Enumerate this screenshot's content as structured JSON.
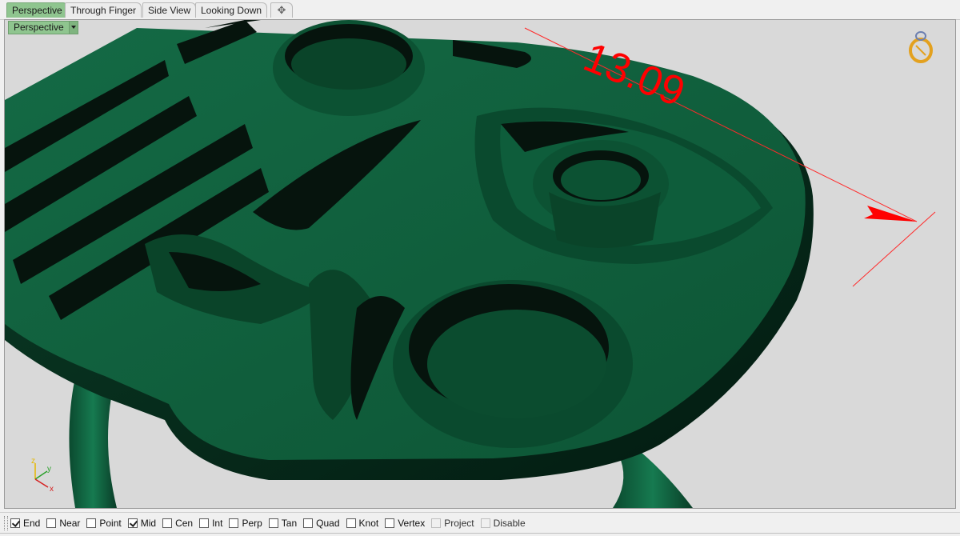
{
  "tabs": [
    {
      "label": "Perspective",
      "active": true
    },
    {
      "label": "Through Finger",
      "active": false
    },
    {
      "label": "Side View",
      "active": false
    },
    {
      "label": "Looking Down",
      "active": false
    }
  ],
  "tab_add_icon": "add-tab-icon",
  "viewport": {
    "label": "Perspective",
    "background": "#d9d9d9",
    "model_color": "#0f5a3a",
    "dimension": {
      "text": "13.09",
      "color": "#ff0000"
    },
    "axes": {
      "x": "x",
      "y": "y",
      "z": "z"
    },
    "navigation_icon": "rotate-gizmo-icon"
  },
  "osnap": [
    {
      "label": "End",
      "checked": true,
      "enabled": true
    },
    {
      "label": "Near",
      "checked": false,
      "enabled": true
    },
    {
      "label": "Point",
      "checked": false,
      "enabled": true
    },
    {
      "label": "Mid",
      "checked": true,
      "enabled": true
    },
    {
      "label": "Cen",
      "checked": false,
      "enabled": true
    },
    {
      "label": "Int",
      "checked": false,
      "enabled": true
    },
    {
      "label": "Perp",
      "checked": false,
      "enabled": true
    },
    {
      "label": "Tan",
      "checked": false,
      "enabled": true
    },
    {
      "label": "Quad",
      "checked": false,
      "enabled": true
    },
    {
      "label": "Knot",
      "checked": false,
      "enabled": true
    },
    {
      "label": "Vertex",
      "checked": false,
      "enabled": true
    },
    {
      "label": "Project",
      "checked": false,
      "enabled": false
    },
    {
      "label": "Disable",
      "checked": false,
      "enabled": false
    }
  ]
}
